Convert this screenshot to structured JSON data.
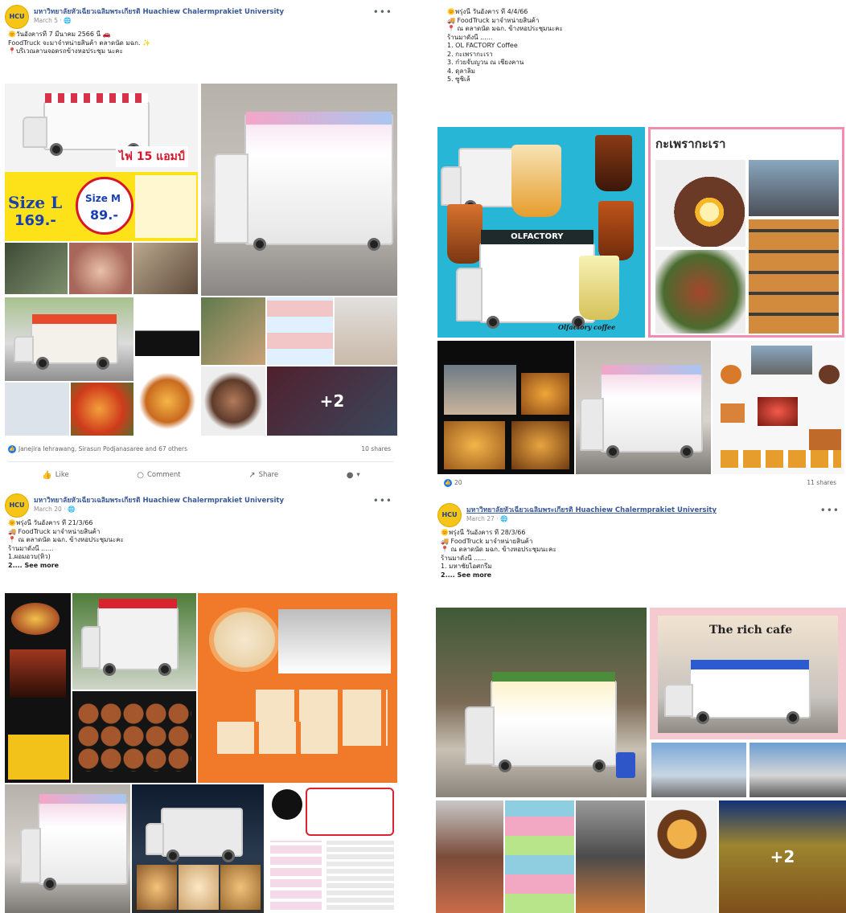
{
  "posts": [
    {
      "page_name": "มหาวิทยาลัยหัวเฉียวเฉลิมพระเกียรติ Huachiew Chalermprakiet University",
      "avatar": "HCU",
      "date": "March 5 · ",
      "lines": [
        "🌞วันอังคารที่ 7 มีนาคม 2566 นี้ 🚗",
        "FoodTruck จะมาจำหน่ายสินค้า ตลาดนัด มฉก. ✨",
        "📍บริเวณลานจอดรถข้างหอประชุม นะคะ"
      ],
      "tile_labels": {
        "promo": "ไฟ 15 แอมป์",
        "size_l": "Size L",
        "price_l": "169.-",
        "size_m": "Size M",
        "price_m": "89.-",
        "more": "+2"
      },
      "reactions": "Janejira Iehrawang, Sirasun Podjanasaree and 67 others",
      "shares": "10 shares",
      "actions": {
        "like": "Like",
        "comment": "Comment",
        "share": "Share"
      }
    },
    {
      "lines": [
        "🌞พรุ่งนี้ วันอังคาร ที่ 4/4/66",
        "🚚 FoodTruck มาจำหน่ายสินค้า",
        "📍 ณ ตลาดนัด มฉก. ข้างหอประชุมนะคะ",
        "ร้านมาดังนี้ ......",
        "1. OL FACTORY Coffee",
        "2. กะเพรากะเรา",
        "3. ก๋วยจั๊บญวน ณ เชียงคาน",
        "4. ดุลาลิ่ม",
        "5. ซูชิเล้"
      ],
      "tile_labels": {
        "kaprao": "กะเพรากะเรา",
        "olfactory": "OLFACTORY",
        "olfactory_sub": "Olfactory coffee"
      },
      "reactions": "20",
      "shares": "11 shares"
    },
    {
      "page_name": "มหาวิทยาลัยหัวเฉียวเฉลิมพระเกียรติ Huachiew Chalermprakiet University",
      "avatar": "HCU",
      "date": "March 20 · ",
      "lines": [
        "🌞พรุ่งนี้ วันอังคาร ที่ 21/3/66",
        "🚚 FoodTruck มาจำหน่ายสินค้า",
        "📍 ณ ตลาดนัด มฉก. ข้างหอประชุมนะคะ",
        "ร้านมาดังนี้ ......",
        "1.ผอมอวบ(หิว)"
      ],
      "see_more": "2.... See more"
    },
    {
      "page_name": "มหาวิทยาลัยหัวเฉียวเฉลิมพระเกียรติ Huachiew Chalermprakiet University",
      "avatar": "HCU",
      "date": "March 27 · ",
      "lines": [
        "🌞พรุ่งนี้ วันอังคาร ที่ 28/3/66",
        "🚚 FoodTruck มาจำหน่ายสินค้า",
        "📍 ณ ตลาดนัด มฉก. ข้างหอประชุมนะคะ",
        "ร้านมาดังนี้ ......",
        "1. มหาชัยไอศกรีม"
      ],
      "see_more": "2.... See more",
      "tile_labels": {
        "rich_cafe": "The rich cafe",
        "more": "+2"
      }
    }
  ],
  "colors": {
    "fb_blue": "#1877f2",
    "link": "#385898",
    "muted": "#65676b"
  },
  "icons": {
    "like": "thumbs-up-icon",
    "comment": "speech-bubble-icon",
    "share": "share-arrow-icon",
    "globe": "globe-icon"
  }
}
